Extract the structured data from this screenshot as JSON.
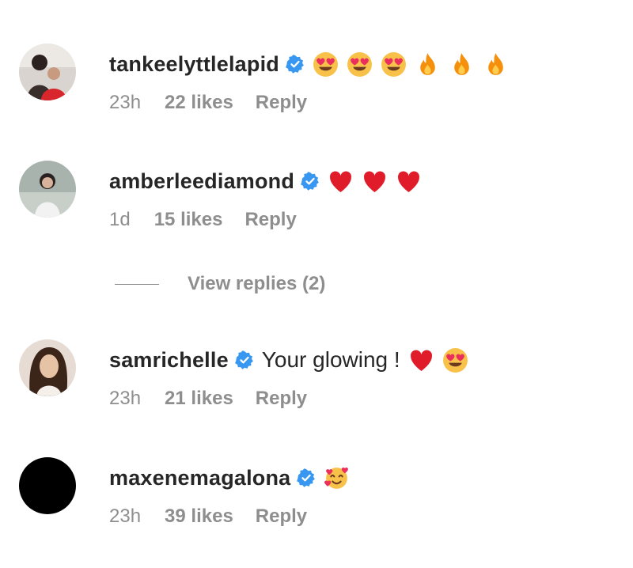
{
  "comments": [
    {
      "username": "tankeelyttlelapid",
      "verified": true,
      "text": "",
      "emojis": [
        "heart-eyes-emoji",
        "heart-eyes-emoji",
        "heart-eyes-emoji",
        "fire-emoji",
        "fire-emoji",
        "fire-emoji"
      ],
      "time": "23h",
      "likes": "22 likes",
      "reply": "Reply"
    },
    {
      "username": "amberleediamond",
      "verified": true,
      "text": "",
      "emojis": [
        "red-heart-emoji",
        "red-heart-emoji",
        "red-heart-emoji"
      ],
      "time": "1d",
      "likes": "15 likes",
      "reply": "Reply",
      "view_replies": "View replies (2)"
    },
    {
      "username": "samrichelle",
      "verified": true,
      "text": "Your glowing !",
      "emojis": [
        "red-heart-emoji",
        "heart-eyes-emoji"
      ],
      "time": "23h",
      "likes": "21 likes",
      "reply": "Reply"
    },
    {
      "username": "maxenemagalona",
      "verified": true,
      "text": "",
      "emojis": [
        "smiling-face-with-hearts-emoji"
      ],
      "time": "23h",
      "likes": "39 likes",
      "reply": "Reply"
    }
  ],
  "colors": {
    "verified": "#3897f0",
    "secondary_text": "#8e8e8e",
    "primary_text": "#262626"
  }
}
